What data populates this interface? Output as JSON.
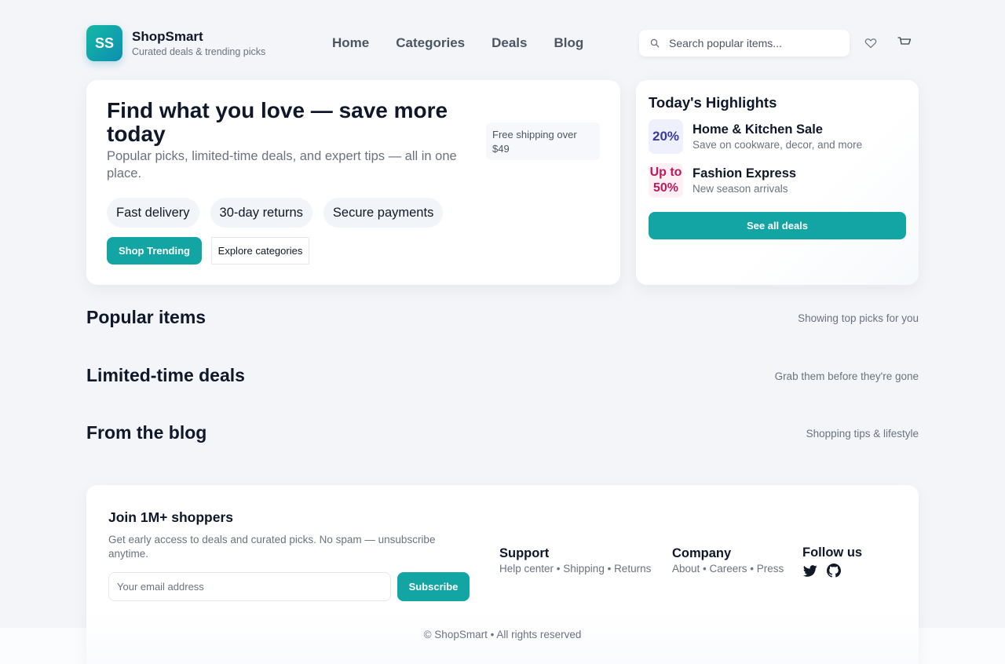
{
  "brand": {
    "logo_text": "SS",
    "name": "ShopSmart",
    "tagline": "Curated deals & trending picks"
  },
  "nav": {
    "items": [
      "Home",
      "Categories",
      "Deals",
      "Blog"
    ]
  },
  "search": {
    "placeholder": "Search popular items..."
  },
  "hero": {
    "title": "Find what you love — save more today",
    "subtitle": "Popular picks, limited-time deals, and expert tips — all in one place.",
    "shipping_note": "Free shipping over $49",
    "chips": [
      "Fast delivery",
      "30-day returns",
      "Secure payments"
    ],
    "primary_label": "Shop Trending",
    "secondary_label": "Explore categories"
  },
  "highlights": {
    "title": "Today's Highlights",
    "items": [
      {
        "badge": "20%",
        "name": "Home & Kitchen Sale",
        "desc": "Save on cookware, decor, and more"
      },
      {
        "badge": "Up to 50%",
        "name": "Fashion Express",
        "desc": "New season arrivals"
      }
    ],
    "cta_label": "See all deals"
  },
  "sections": [
    {
      "title": "Popular items",
      "note": "Showing top picks for you"
    },
    {
      "title": "Limited-time deals",
      "note": "Grab them before they're gone"
    },
    {
      "title": "From the blog",
      "note": "Shopping tips & lifestyle"
    }
  ],
  "footer": {
    "title": "Join 1M+ shoppers",
    "desc": "Get early access to deals and curated picks. No spam — unsubscribe anytime.",
    "email_placeholder": "Your email address",
    "subscribe_label": "Subscribe",
    "support": {
      "title": "Support",
      "links": [
        "Help center",
        "Shipping",
        "Returns"
      ]
    },
    "company": {
      "title": "Company",
      "links": [
        "About",
        "Careers",
        "Press"
      ]
    },
    "follow": {
      "title": "Follow us",
      "icons": [
        "twitter-icon",
        "github-icon"
      ]
    },
    "copyright": "© ShopSmart • All rights reserved"
  },
  "colors": {
    "accent": "#12a5a4",
    "badge_indigo": "#3b3a9e",
    "badge_pink": "#be185d"
  }
}
